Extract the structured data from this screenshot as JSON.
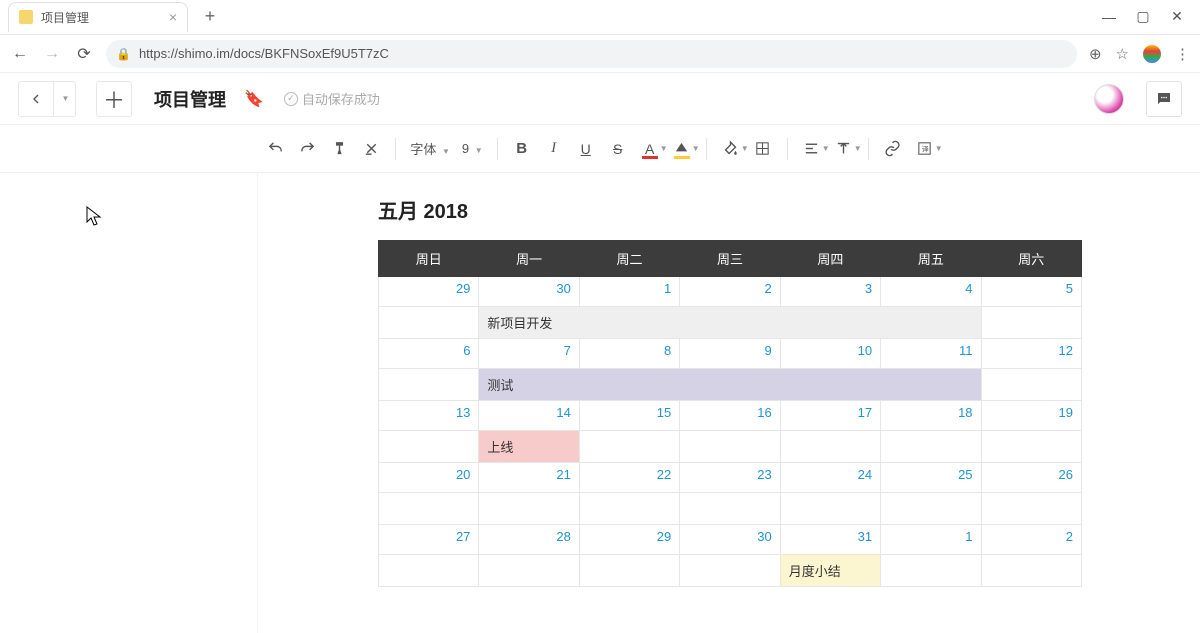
{
  "browser": {
    "tab_title": "项目管理",
    "url": "https://shimo.im/docs/BKFNSoxEf9U5T7zC"
  },
  "header": {
    "doc_title": "项目管理",
    "save_status": "自动保存成功"
  },
  "toolbar": {
    "font_label": "字体",
    "size_label": "9"
  },
  "calendar": {
    "title": "五月 2018",
    "weekdays": [
      "周日",
      "周一",
      "周二",
      "周三",
      "周四",
      "周五",
      "周六"
    ],
    "weeks": [
      {
        "dates": [
          "29",
          "30",
          "1",
          "2",
          "3",
          "4",
          "5"
        ],
        "event": {
          "text": "新项目开发",
          "start": 1,
          "span": 5,
          "cls": "ev-gray"
        }
      },
      {
        "dates": [
          "6",
          "7",
          "8",
          "9",
          "10",
          "11",
          "12"
        ],
        "event": {
          "text": "测试",
          "start": 1,
          "span": 5,
          "cls": "ev-purple"
        }
      },
      {
        "dates": [
          "13",
          "14",
          "15",
          "16",
          "17",
          "18",
          "19"
        ],
        "event": {
          "text": "上线",
          "start": 1,
          "span": 1,
          "cls": "ev-pink"
        }
      },
      {
        "dates": [
          "20",
          "21",
          "22",
          "23",
          "24",
          "25",
          "26"
        ],
        "event": null
      },
      {
        "dates": [
          "27",
          "28",
          "29",
          "30",
          "31",
          "1",
          "2"
        ],
        "event": {
          "text": "月度小结",
          "start": 4,
          "span": 1,
          "cls": "ev-yellow"
        }
      }
    ]
  }
}
